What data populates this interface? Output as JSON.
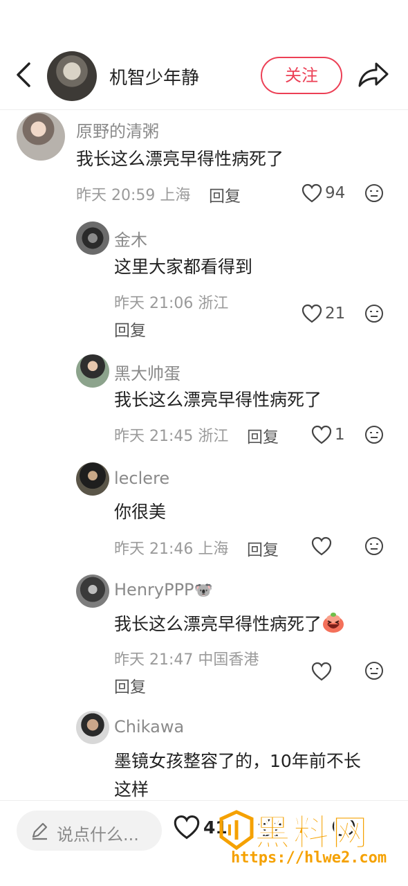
{
  "header": {
    "account_name": "机智少年静",
    "follow_label": "关注"
  },
  "comments": [
    {
      "username": "原野的清粥",
      "text": "我长这么漂亮早得性病死了",
      "meta": "昨天 20:59 上海",
      "reply_label": "回复",
      "likes": "94",
      "replies": [
        {
          "username": "金木",
          "text": "这里大家都看得到",
          "meta": "昨天 21:06 浙江",
          "reply_label": "回复",
          "likes": "21"
        },
        {
          "username": "黑大帅蛋",
          "text": "我长这么漂亮早得性病死了",
          "meta": "昨天 21:45 浙江",
          "reply_label": "回复",
          "likes": "1"
        },
        {
          "username": "leclere",
          "text": "你很美",
          "meta": "昨天 21:46 上海",
          "reply_label": "回复",
          "likes": ""
        },
        {
          "username": "HenryPPP",
          "username_emoji": "🐨",
          "text": "我长这么漂亮早得性病死了",
          "meta": "昨天 21:47 中国香港",
          "reply_label": "回复",
          "likes": ""
        },
        {
          "username": "Chikawa",
          "text_line1": "墨镜女孩整容了的，10年前不长",
          "text_line2": "这样"
        }
      ]
    }
  ],
  "bottom_bar": {
    "input_placeholder": "说点什么...",
    "likes": "41",
    "collects": "",
    "comments": ""
  },
  "watermark": {
    "logo_text": "黑料网",
    "url": "https://hlwe2.com"
  },
  "colors": {
    "accent": "#ec3f55",
    "watermark": "#f5a100"
  }
}
